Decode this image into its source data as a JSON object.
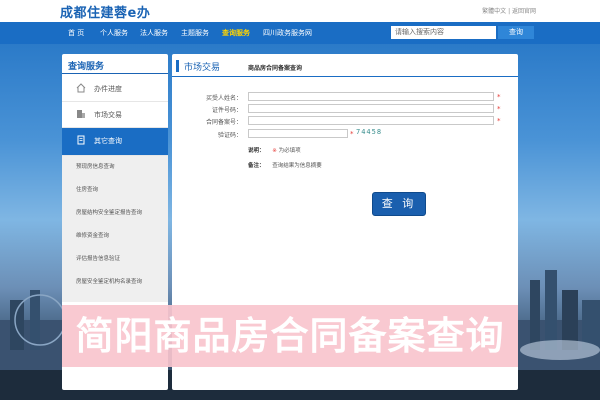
{
  "header": {
    "logo": "成都住建蓉e办",
    "top_links": "繁體中文 | 返回官网"
  },
  "nav": {
    "items": [
      "首 页",
      "个人服务",
      "法人服务",
      "主题服务",
      "查询服务",
      "四川政务服务网"
    ],
    "active_index": 4,
    "search_placeholder": "请输入搜索内容",
    "search_button": "查询"
  },
  "sidebar": {
    "title": "查询服务",
    "items": [
      {
        "label": "办件进度",
        "icon": "home-icon"
      },
      {
        "label": "市场交易",
        "icon": "building-icon"
      },
      {
        "label": "其它查询",
        "icon": "document-icon"
      }
    ],
    "active_index": 2,
    "sub_items": [
      "预现房信息查询",
      "住房查询",
      "房屋结构安全鉴定报告查询",
      "维修资金查询",
      "评估报告信息验证",
      "房屋安全鉴定机构名录查询"
    ]
  },
  "main": {
    "section_title": "市场交易",
    "subtitle": "商品房合同备案查询",
    "fields": [
      {
        "label": "买受人姓名：",
        "value": "",
        "required": true
      },
      {
        "label": "证件号码：",
        "value": "",
        "required": true
      },
      {
        "label": "合同备案号：",
        "value": "",
        "required": true
      },
      {
        "label": "验证码：",
        "value": "",
        "required": false
      }
    ],
    "captcha_text": "74458",
    "required_mark": "*",
    "note_label": "说明：",
    "note_star": "※",
    "note_text": "为必填项",
    "remark_label": "备注：",
    "remark_text": "查询结果为信息摘要",
    "query_button": "查 询"
  },
  "banner": {
    "text": "简阳商品房合同备案查询"
  },
  "colors": {
    "brand_blue": "#1a6dc4",
    "nav_active": "#ffd400",
    "required_red": "#e53935",
    "banner_pink": "#f8c4cd"
  }
}
